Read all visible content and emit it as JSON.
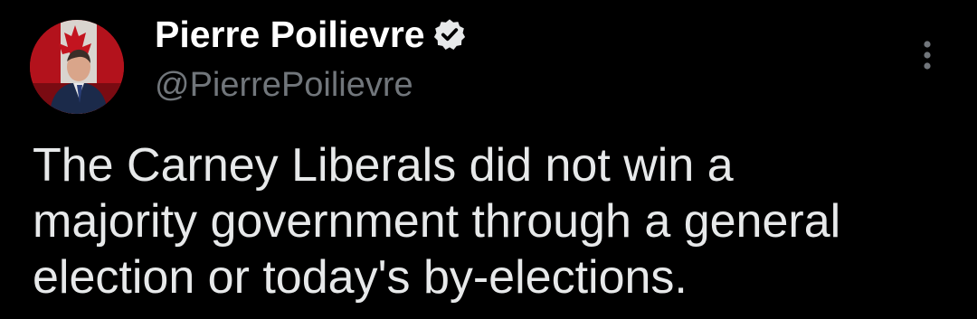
{
  "author": {
    "display_name": "Pierre Poilievre",
    "handle": "@PierrePoilievre",
    "verified_icon": "verified-badge-icon"
  },
  "tweet": {
    "text": "The Carney Liberals did not win a\nmajority government through a general\nelection or today's by-elections."
  },
  "icons": {
    "more": "more-vertical-icon"
  },
  "colors": {
    "background": "#000000",
    "name": "#ffffff",
    "handle": "#71767b",
    "body_text": "#e7e9ea"
  }
}
